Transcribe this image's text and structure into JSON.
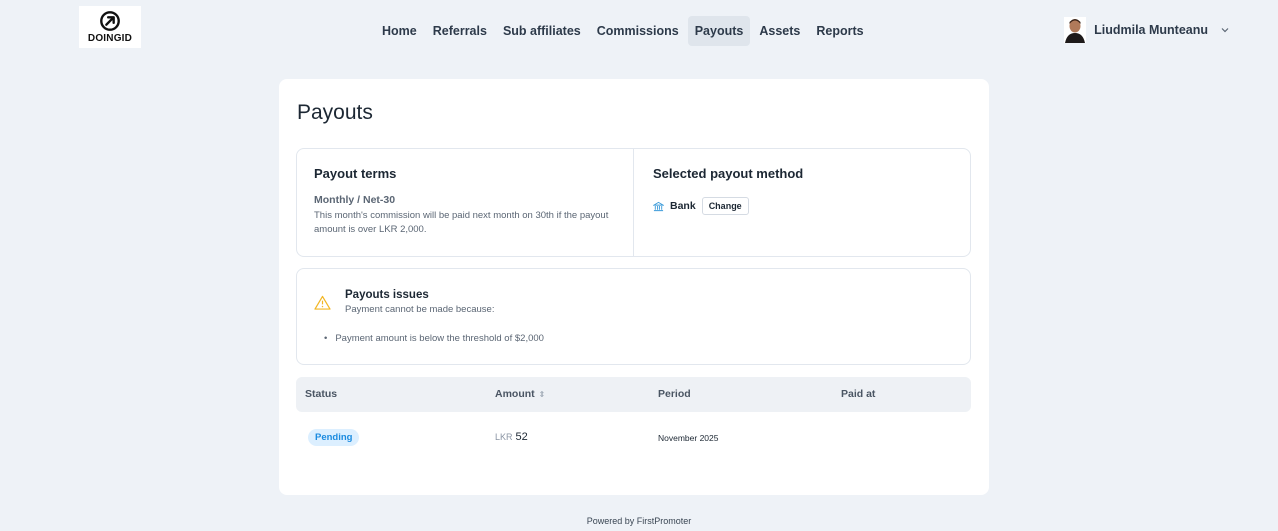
{
  "brand": {
    "name": "DOINGID"
  },
  "nav": {
    "items": [
      {
        "label": "Home"
      },
      {
        "label": "Referrals"
      },
      {
        "label": "Sub affiliates"
      },
      {
        "label": "Commissions"
      },
      {
        "label": "Payouts",
        "active": true
      },
      {
        "label": "Assets"
      },
      {
        "label": "Reports"
      }
    ]
  },
  "user": {
    "name": "Liudmila Munteanu",
    "menu_icon": "chevron-down-icon"
  },
  "page": {
    "title": "Payouts"
  },
  "payout_terms": {
    "heading": "Payout terms",
    "schedule": "Monthly / Net-30",
    "description": "This month's commission will be paid next month on 30th if the payout amount is over LKR 2,000."
  },
  "payout_method": {
    "heading": "Selected payout method",
    "method": "Bank",
    "icon": "bank-icon",
    "change_label": "Change"
  },
  "issues": {
    "icon": "warning-icon",
    "title": "Payouts issues",
    "subtitle": "Payment cannot be made because:",
    "items": [
      "Payment amount is below the threshold of $2,000"
    ]
  },
  "table": {
    "columns": [
      "Status",
      "Amount",
      "Period",
      "Paid at"
    ],
    "rows": [
      {
        "status": "Pending",
        "currency": "LKR",
        "amount": "52",
        "period": "November 2025",
        "paid_at": ""
      }
    ]
  },
  "footer": {
    "text": "Powered by FirstPromoter"
  },
  "colors": {
    "background": "#eef2f7",
    "badge_bg": "#dcefff",
    "badge_text": "#1b8be0",
    "warning": "#f2b624"
  }
}
